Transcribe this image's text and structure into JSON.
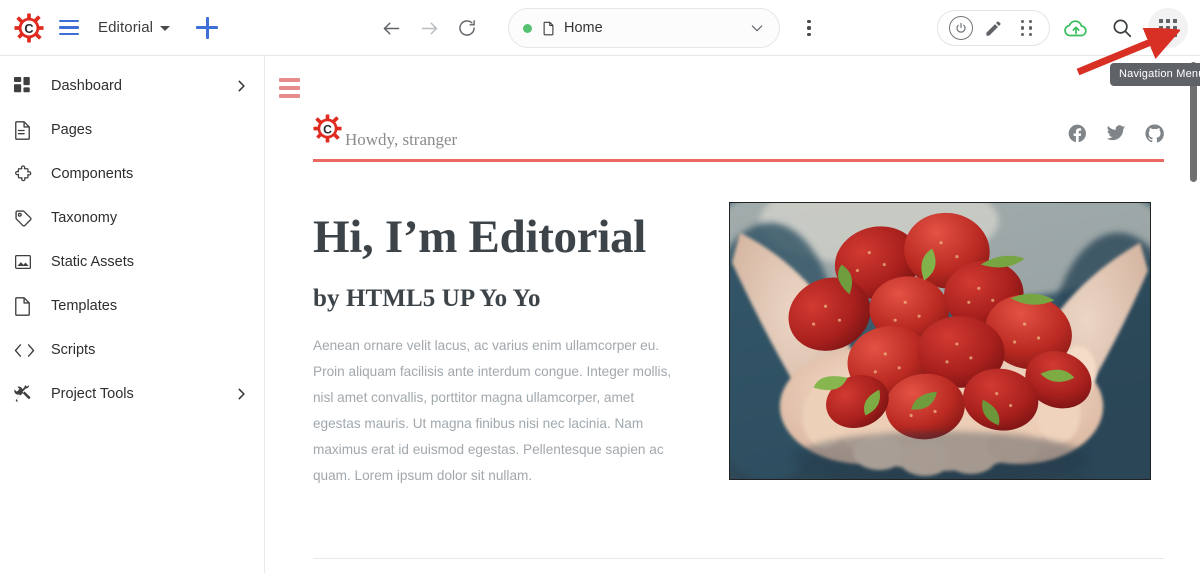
{
  "topbar": {
    "logo_icon": "gear-c-logo-icon",
    "menu_icon": "hamburger-menu-icon",
    "site_name": "Editorial",
    "caret_icon": "caret-down-icon",
    "add_icon": "plus-icon",
    "back_icon": "arrow-left-icon",
    "forward_icon": "arrow-right-icon",
    "reload_icon": "reload-icon",
    "kebab_icon": "more-vertical-icon",
    "omnibox": {
      "status_dot_color": "#56c271",
      "page_icon": "page-file-icon",
      "page_label": "Home",
      "chevron_icon": "chevron-down-icon"
    },
    "right_icons": {
      "power_label": "power-icon",
      "edit_label": "pencil-edit-icon",
      "grip_label": "grip-dots-icon",
      "cloud_label": "cloud-upload-icon",
      "cloud_color": "#3bbf5e",
      "search_label": "search-icon",
      "apps_label": "apps-grid-icon"
    }
  },
  "tooltip": {
    "text": "Navigation Menu",
    "bg": "#5f6368"
  },
  "annotation": {
    "arrow_color": "#d93025",
    "points_to": "apps-grid-icon"
  },
  "sidebar": {
    "items": [
      {
        "label": "Dashboard",
        "icon": "dashboard-grid-icon",
        "has_chevron": true
      },
      {
        "label": "Pages",
        "icon": "page-lines-icon",
        "has_chevron": false
      },
      {
        "label": "Components",
        "icon": "puzzle-piece-icon",
        "has_chevron": false
      },
      {
        "label": "Taxonomy",
        "icon": "tag-icon",
        "has_chevron": false
      },
      {
        "label": "Static Assets",
        "icon": "image-icon",
        "has_chevron": false
      },
      {
        "label": "Templates",
        "icon": "file-blank-icon",
        "has_chevron": false
      },
      {
        "label": "Scripts",
        "icon": "code-brackets-icon",
        "has_chevron": false
      },
      {
        "label": "Project Tools",
        "icon": "tools-wrench-icon",
        "has_chevron": true
      }
    ]
  },
  "content": {
    "menu_icon": "hamburger-menu-red-icon",
    "header": {
      "logo_icon": "gear-c-logo-icon",
      "greeting": "Howdy, stranger",
      "rule_color": "#ea6a62",
      "socials": [
        {
          "name": "facebook-icon"
        },
        {
          "name": "twitter-icon"
        },
        {
          "name": "github-icon"
        }
      ]
    },
    "hero": {
      "title": "Hi, I’m Editorial",
      "subtitle": "by HTML5 UP Yo Yo",
      "paragraph": "Aenean ornare velit lacus, ac varius enim ullamcorper eu. Proin aliquam facilisis ante interdum congue. Integer mollis, nisl amet convallis, porttitor magna ullamcorper, amet egestas mauris. Ut magna finibus nisi nec lacinia. Nam maximus erat id euismod egestas. Pellentesque sapien ac quam. Lorem ipsum dolor sit nullam.",
      "image_alt": "hands-holding-strawberries-photo"
    }
  },
  "scrollbar": {
    "name": "vertical-scrollbar",
    "thumb_color": "#707070"
  }
}
